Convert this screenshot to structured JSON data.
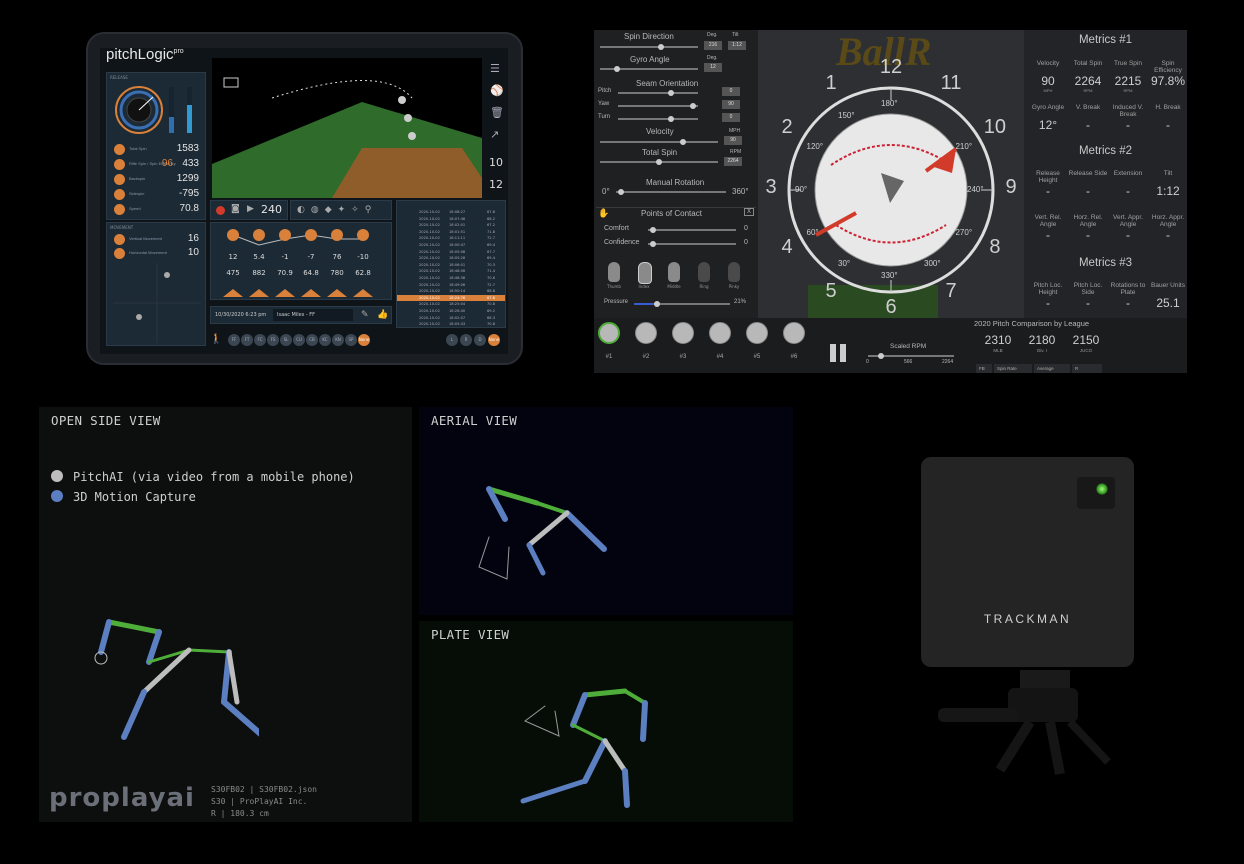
{
  "pitchlogic": {
    "logo": "pitchLogic",
    "logo_sup": "pro",
    "section_release": "RELEASE",
    "section_movement": "MOVEMENT",
    "metrics": [
      {
        "label": "Total Spin",
        "value": "1583"
      },
      {
        "label": "Rifle Spin / Spin Efficiency",
        "value": "433",
        "prefix": "96"
      },
      {
        "label": "Backspin",
        "value": "1299"
      },
      {
        "label": "Sidespin",
        "value": "-795"
      },
      {
        "label": "Speed",
        "value": "70.8"
      }
    ],
    "movement": [
      {
        "label": "Vertical Movement",
        "value": "16"
      },
      {
        "label": "Horizontal Movement",
        "value": "10"
      }
    ],
    "side_values": [
      "10",
      "12"
    ],
    "record_count": "240",
    "bar_values": [
      "12",
      "5.4",
      "-1",
      "-7",
      "76",
      "-10"
    ],
    "bar_values2": [
      "475",
      "882",
      "70.9",
      "64.8",
      "780",
      "62.8"
    ],
    "date_value": "10/30/2020  6:23 pm",
    "pitcher_value": "Isaac Miles - FF",
    "pitch_types": [
      "FF",
      "FT",
      "FC",
      "FS",
      "SL",
      "CU",
      "CB",
      "KC",
      "KN",
      "SP",
      "None"
    ],
    "hand_options": [
      "L",
      "R",
      "D",
      "None"
    ],
    "list_rows": [
      {
        "date": "2020-10-02",
        "time": "18:08:27",
        "v": "67.8"
      },
      {
        "date": "2020-10-02",
        "time": "18:07:48",
        "v": "68.2"
      },
      {
        "date": "2020-10-02",
        "time": "18:02:01",
        "v": "67.2"
      },
      {
        "date": "2020-10-02",
        "time": "18:01:51",
        "v": "71.8"
      },
      {
        "date": "2020-10-02",
        "time": "18:11:11",
        "v": "72.7"
      },
      {
        "date": "2020-10-02",
        "time": "18:00:47",
        "v": "69.4"
      },
      {
        "date": "2020-10-02",
        "time": "18:05:08",
        "v": "67.7"
      },
      {
        "date": "2020-10-02",
        "time": "18:05:28",
        "v": "69.4"
      },
      {
        "date": "2020-10-02",
        "time": "18:06:01",
        "v": "70.3"
      },
      {
        "date": "2020-10-02",
        "time": "18:48:06",
        "v": "71.4"
      },
      {
        "date": "2020-10-02",
        "time": "18:48:38",
        "v": "70.6"
      },
      {
        "date": "2020-10-02",
        "time": "18:49:06",
        "v": "72.7"
      },
      {
        "date": "2020-10-02",
        "time": "18:50:14",
        "v": "68.8"
      },
      {
        "date": "2020-10-02",
        "time": "18:24:76",
        "v": "67.8"
      },
      {
        "date": "2020-10-02",
        "time": "18:25:04",
        "v": "70.8"
      },
      {
        "date": "2020-10-02",
        "time": "18:26:40",
        "v": "69.2"
      },
      {
        "date": "2020-10-02",
        "time": "18:02:07",
        "v": "68.3"
      },
      {
        "date": "2020-10-02",
        "time": "18:05:43",
        "v": "70.8"
      }
    ]
  },
  "ballr": {
    "logo": "BallR",
    "spin_direction": "Spin Direction",
    "deg_label": "Deg.",
    "tilt_label": "Tilt",
    "spin_deg": "216",
    "spin_tilt": "1:12",
    "gyro_angle": "Gyro Angle",
    "gyro_deg": "12",
    "seam_orientation": "Seam Orientation",
    "seam_pitch_label": "Pitch",
    "seam_yaw_label": "Yaw",
    "seam_turn_label": "Turn",
    "seam_pitch": "0",
    "seam_yaw": "90",
    "seam_turn": "0",
    "velocity_label": "Velocity",
    "velocity_unit": "MPH",
    "velocity_value": "90",
    "total_spin_label": "Total Spin",
    "total_spin_unit": "RPM",
    "total_spin_value": "2264",
    "manual_rotation": "Manual Rotation",
    "rot_min": "0°",
    "rot_max": "360°",
    "points_of_contact": "Points of Contact",
    "close_x": "X",
    "comfort_label": "Comfort",
    "comfort_value": "0",
    "confidence_label": "Confidence",
    "confidence_value": "0",
    "fingers": [
      "Thumb",
      "Index",
      "Middle",
      "Ring",
      "Pinky"
    ],
    "pressure_label": "Pressure",
    "pressure_value": "21%",
    "dial_numbers": [
      "12",
      "1",
      "2",
      "3",
      "4",
      "5",
      "6",
      "7",
      "8",
      "9",
      "10",
      "11"
    ],
    "dial_degrees": [
      "180°",
      "150°",
      "120°",
      "90°",
      "60°",
      "30°",
      "330°",
      "300°",
      "270°",
      "240°",
      "210°"
    ],
    "metrics1_title": "Metrics #1",
    "metrics1": [
      {
        "label": "Velocity",
        "value": "90",
        "unit": "MPH"
      },
      {
        "label": "Total Spin",
        "value": "2264",
        "unit": "RPM"
      },
      {
        "label": "True Spin",
        "value": "2215",
        "unit": "RPM"
      },
      {
        "label": "Spin Efficiency",
        "value": "97.8%",
        "unit": ""
      },
      {
        "label": "Gyro Angle",
        "value": "12°",
        "unit": ""
      },
      {
        "label": "V. Break",
        "value": "-",
        "unit": ""
      },
      {
        "label": "Induced V. Break",
        "value": "-",
        "unit": ""
      },
      {
        "label": "H. Break",
        "value": "-",
        "unit": ""
      }
    ],
    "metrics2_title": "Metrics #2",
    "metrics2": [
      {
        "label": "Release Height",
        "value": "-"
      },
      {
        "label": "Release Side",
        "value": "-"
      },
      {
        "label": "Extension",
        "value": "-"
      },
      {
        "label": "Tilt",
        "value": "1:12"
      },
      {
        "label": "Vert. Rel. Angle",
        "value": "-"
      },
      {
        "label": "Horz. Rel. Angle",
        "value": "-"
      },
      {
        "label": "Vert. Appr. Angle",
        "value": "-"
      },
      {
        "label": "Horz. Appr. Angle",
        "value": "-"
      }
    ],
    "metrics3_title": "Metrics #3",
    "metrics3": [
      {
        "label": "Pitch Loc. Height",
        "value": "-"
      },
      {
        "label": "Pitch Loc. Side",
        "value": "-"
      },
      {
        "label": "Rotations to Plate",
        "value": "-"
      },
      {
        "label": "Bauer Units",
        "value": "25.1"
      }
    ],
    "thumbs": [
      "#1",
      "#2",
      "#3",
      "#4",
      "#5",
      "#6"
    ],
    "scaled_rpm": "Scaled RPM",
    "rpm_min": "0",
    "rpm_mid": "566",
    "rpm_max": "2264",
    "comparison_title": "2020 Pitch Comparison by League",
    "comparison": [
      {
        "value": "2310",
        "league": "MLB"
      },
      {
        "value": "2180",
        "league": "Div. I"
      },
      {
        "value": "2150",
        "league": "JUCO"
      }
    ],
    "bottom_tabs": [
      "FB",
      "Spin Rate",
      "Average",
      "R"
    ]
  },
  "proplayai": {
    "side_title": "OPEN SIDE VIEW",
    "aerial_title": "AERIAL VIEW",
    "plate_title": "PLATE VIEW",
    "legend": [
      {
        "label": "PitchAI (via video from a mobile phone)",
        "color": "#bdbdbd"
      },
      {
        "label": "3D Motion Capture",
        "color": "#5b7fc0"
      }
    ],
    "logo": "proplayai",
    "meta_line1": "S30FB02  |  S30FB02.json",
    "meta_line2": "S30  |  ProPlayAI Inc.",
    "meta_line3": "R  |  180.3 cm"
  },
  "trackman": {
    "brand": "TRACKMAN"
  },
  "colors": {
    "accent_orange": "#d9803a",
    "mocap_blue": "#5b7fc0",
    "bone_green": "#4fae3a",
    "dial_red": "#d23a2a"
  }
}
